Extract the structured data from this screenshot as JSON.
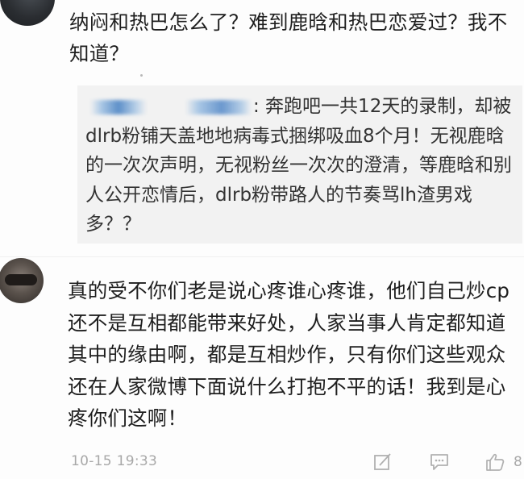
{
  "comments": [
    {
      "text": "纳闷和热巴怎么了？难到鹿晗和热巴恋爱过？我不知道？",
      "quote": {
        "line1_suffix": ": 奔跑吧一共12天的录制，",
        "body": "却被dlrb粉铺天盖地地病毒式捆绑吸血8个月！无视鹿晗的一次次声明，无视粉丝一次次的澄清，等鹿晗和别人公开恋情后，dlrb粉带路人的节奏骂lh渣男戏多？？"
      }
    },
    {
      "text": "真的受不你们老是说心疼谁心疼谁，他们自己炒cp还不是互相都能带来好处，人家当事人肯定都知道其中的缘由啊，都是互相炒作，只有你们这些观众还在人家微博下面说什么打抱不平的话！我到是心疼你们这啊！",
      "timestamp": "10-15 19:33",
      "actions": {
        "repost_icon": "edit-square-icon",
        "comment_icon": "comment-bubble-icon",
        "like_icon": "thumbs-up-icon",
        "like_count": "8"
      }
    }
  ],
  "colors": {
    "text": "#1e1e1e",
    "meta": "#a8a8a8",
    "quote_bg": "#f2f2f2",
    "mask_blue": "#5d8fc8"
  }
}
